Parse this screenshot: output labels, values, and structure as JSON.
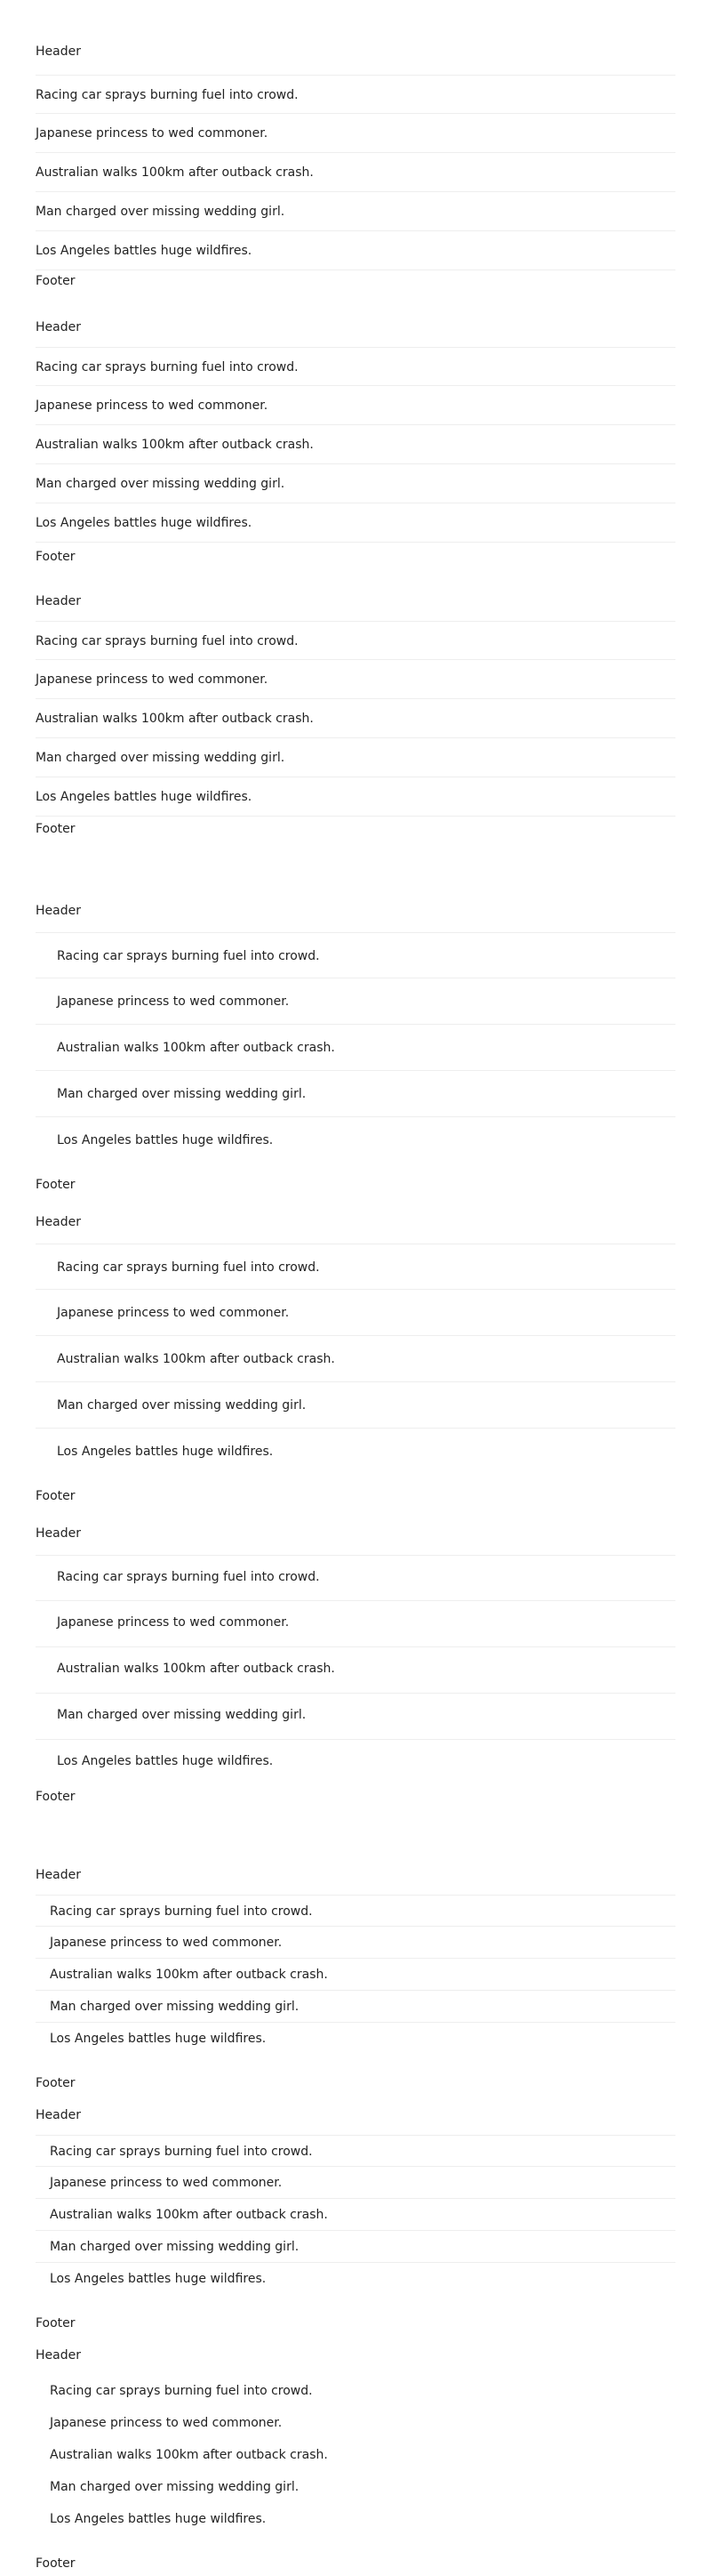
{
  "sections": [
    {
      "name": "plain-list",
      "groups": [
        {
          "header": "Header",
          "items": [
            "Racing car sprays burning fuel into crowd.",
            "Japanese princess to wed commoner.",
            "Australian walks 100km after outback crash.",
            "Man charged over missing wedding girl.",
            "Los Angeles battles huge wildfires."
          ],
          "footer": "Footer"
        },
        {
          "header": "Header",
          "items": [
            "Racing car sprays burning fuel into crowd.",
            "Japanese princess to wed commoner.",
            "Australian walks 100km after outback crash.",
            "Man charged over missing wedding girl.",
            "Los Angeles battles huge wildfires."
          ],
          "footer": "Footer"
        },
        {
          "header": "Header",
          "items": [
            "Racing car sprays burning fuel into crowd.",
            "Japanese princess to wed commoner.",
            "Australian walks 100km after outback crash.",
            "Man charged over missing wedding girl.",
            "Los Angeles battles huge wildfires."
          ],
          "footer": "Footer"
        }
      ]
    },
    {
      "name": "padded-list",
      "groups": [
        {
          "header": "Header",
          "items": [
            "Racing car sprays burning fuel into crowd.",
            "Japanese princess to wed commoner.",
            "Australian walks 100km after outback crash.",
            "Man charged over missing wedding girl.",
            "Los Angeles battles huge wildfires."
          ],
          "footer": "Footer"
        },
        {
          "header": "Header",
          "items": [
            "Racing car sprays burning fuel into crowd.",
            "Japanese princess to wed commoner.",
            "Australian walks 100km after outback crash.",
            "Man charged over missing wedding girl.",
            "Los Angeles battles huge wildfires."
          ],
          "footer": "Footer"
        },
        {
          "header": "Header",
          "items": [
            "Racing car sprays burning fuel into crowd.",
            "Japanese princess to wed commoner.",
            "Australian walks 100km after outback crash.",
            "Man charged over missing wedding girl.",
            "Los Angeles battles huge wildfires."
          ],
          "footer": "Footer"
        }
      ]
    },
    {
      "name": "compact-list",
      "groups": [
        {
          "header": "Header",
          "items": [
            "Racing car sprays burning fuel into crowd.",
            "Japanese princess to wed commoner.",
            "Australian walks 100km after outback crash.",
            "Man charged over missing wedding girl.",
            "Los Angeles battles huge wildfires."
          ],
          "footer": "Footer"
        },
        {
          "header": "Header",
          "items": [
            "Racing car sprays burning fuel into crowd.",
            "Japanese princess to wed commoner.",
            "Australian walks 100km after outback crash.",
            "Man charged over missing wedding girl.",
            "Los Angeles battles huge wildfires."
          ],
          "footer": "Footer"
        },
        {
          "header": "Header",
          "items": [
            "Racing car sprays burning fuel into crowd.",
            "Japanese princess to wed commoner.",
            "Australian walks 100km after outback crash.",
            "Man charged over missing wedding girl.",
            "Los Angeles battles huge wildfires."
          ],
          "footer": "Footer"
        }
      ]
    }
  ]
}
